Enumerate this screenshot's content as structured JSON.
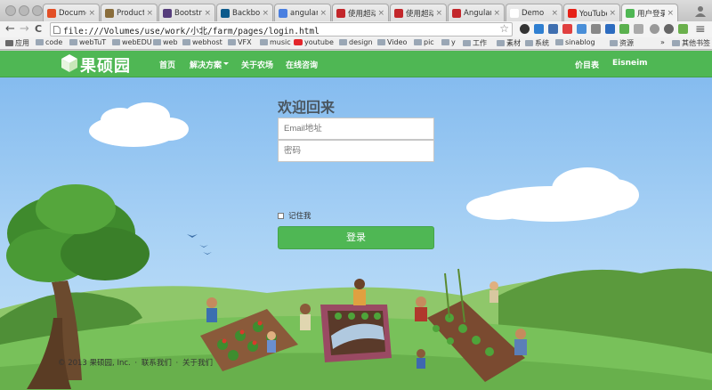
{
  "browser": {
    "tabs": [
      {
        "title": "Document",
        "color": "#e34f26"
      },
      {
        "title": "Production",
        "color": "#8a6d3b"
      },
      {
        "title": "Bootstrap",
        "color": "#563d7c"
      },
      {
        "title": "Backbone.",
        "color": "#0d5b8c"
      },
      {
        "title": "angularjs",
        "color": "#4a7fe0"
      },
      {
        "title": "使用超动感",
        "color": "#c3272b"
      },
      {
        "title": "使用超动感",
        "color": "#c3272b"
      },
      {
        "title": "AngularJS",
        "color": "#c3272b"
      },
      {
        "title": "Demo",
        "color": "#ffffff"
      },
      {
        "title": "YouTube精",
        "color": "#e62117"
      },
      {
        "title": "用户登录",
        "color": "#4fb754"
      }
    ],
    "tab_close": "×",
    "url": "file:///Volumes/use/work/小北/farm/pages/login.html",
    "nav": {
      "back": "←",
      "forward": "→",
      "reload": "C",
      "menu": "≡"
    },
    "star": "☆",
    "bookmarks": [
      "应用",
      "code",
      "webTuT",
      "webEDU",
      "web",
      "webhost",
      "VFX",
      "music",
      "youtube",
      "design",
      "Video",
      "pic",
      "y",
      "工作",
      "素材",
      "系统",
      "sinablog",
      "资源"
    ],
    "bookmarks_more": "»",
    "other_bookmarks": "其他书签"
  },
  "site": {
    "logo_text": "果硕园",
    "nav_items": [
      "首页",
      "解决方案",
      "关于农场",
      "在线咨询"
    ],
    "nav_right": [
      "价目表",
      "Eisneim"
    ],
    "brand_color": "#4fb754"
  },
  "login": {
    "title": "欢迎回来",
    "email_placeholder": "Email地址",
    "password_placeholder": "密码",
    "remember_label": "记住我",
    "submit_label": "登录"
  },
  "footer": {
    "copyright": "© 2013 果硕园, Inc.",
    "links": [
      "联系我们",
      "关于我们"
    ],
    "separator": "·"
  }
}
